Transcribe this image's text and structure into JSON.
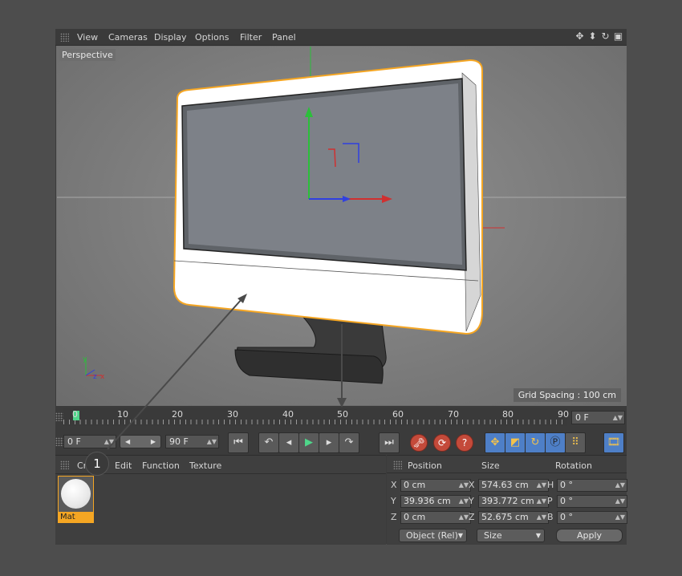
{
  "menubar": {
    "items": [
      "View",
      "Cameras",
      "Display",
      "Options",
      "Filter",
      "Panel"
    ]
  },
  "viewport": {
    "label": "Perspective",
    "grid_spacing": "Grid Spacing : 100 cm"
  },
  "timeline": {
    "ticks": [
      "0",
      "10",
      "20",
      "30",
      "40",
      "50",
      "60",
      "70",
      "80",
      "90"
    ],
    "end_frame": "0 F"
  },
  "transport": {
    "start_field": "0 F",
    "end_field": "90 F"
  },
  "material_manager": {
    "menus": [
      "Create",
      "Edit",
      "Function",
      "Texture"
    ],
    "material_name": "Mat"
  },
  "coordinates": {
    "headers": [
      "Position",
      "Size",
      "Rotation"
    ],
    "rows": [
      {
        "axis": "X",
        "pos": "0 cm",
        "size_axis": "X",
        "size": "574.63 cm",
        "rot_axis": "H",
        "rot": "0 °"
      },
      {
        "axis": "Y",
        "pos": "39.936 cm",
        "size_axis": "Y",
        "size": "393.772 cm",
        "rot_axis": "P",
        "rot": "0 °"
      },
      {
        "axis": "Z",
        "pos": "0 cm",
        "size_axis": "Z",
        "size": "52.675 cm",
        "rot_axis": "B",
        "rot": "0 °"
      }
    ],
    "mode_dropdown": "Object (Rel)",
    "size_dropdown": "Size",
    "apply_label": "Apply"
  },
  "callout": {
    "number": "1"
  },
  "colors": {
    "selection": "#f5a623",
    "axis_x": "#e03030",
    "axis_y": "#30c040",
    "axis_z": "#3040e0",
    "playhead": "#4fd68a"
  }
}
